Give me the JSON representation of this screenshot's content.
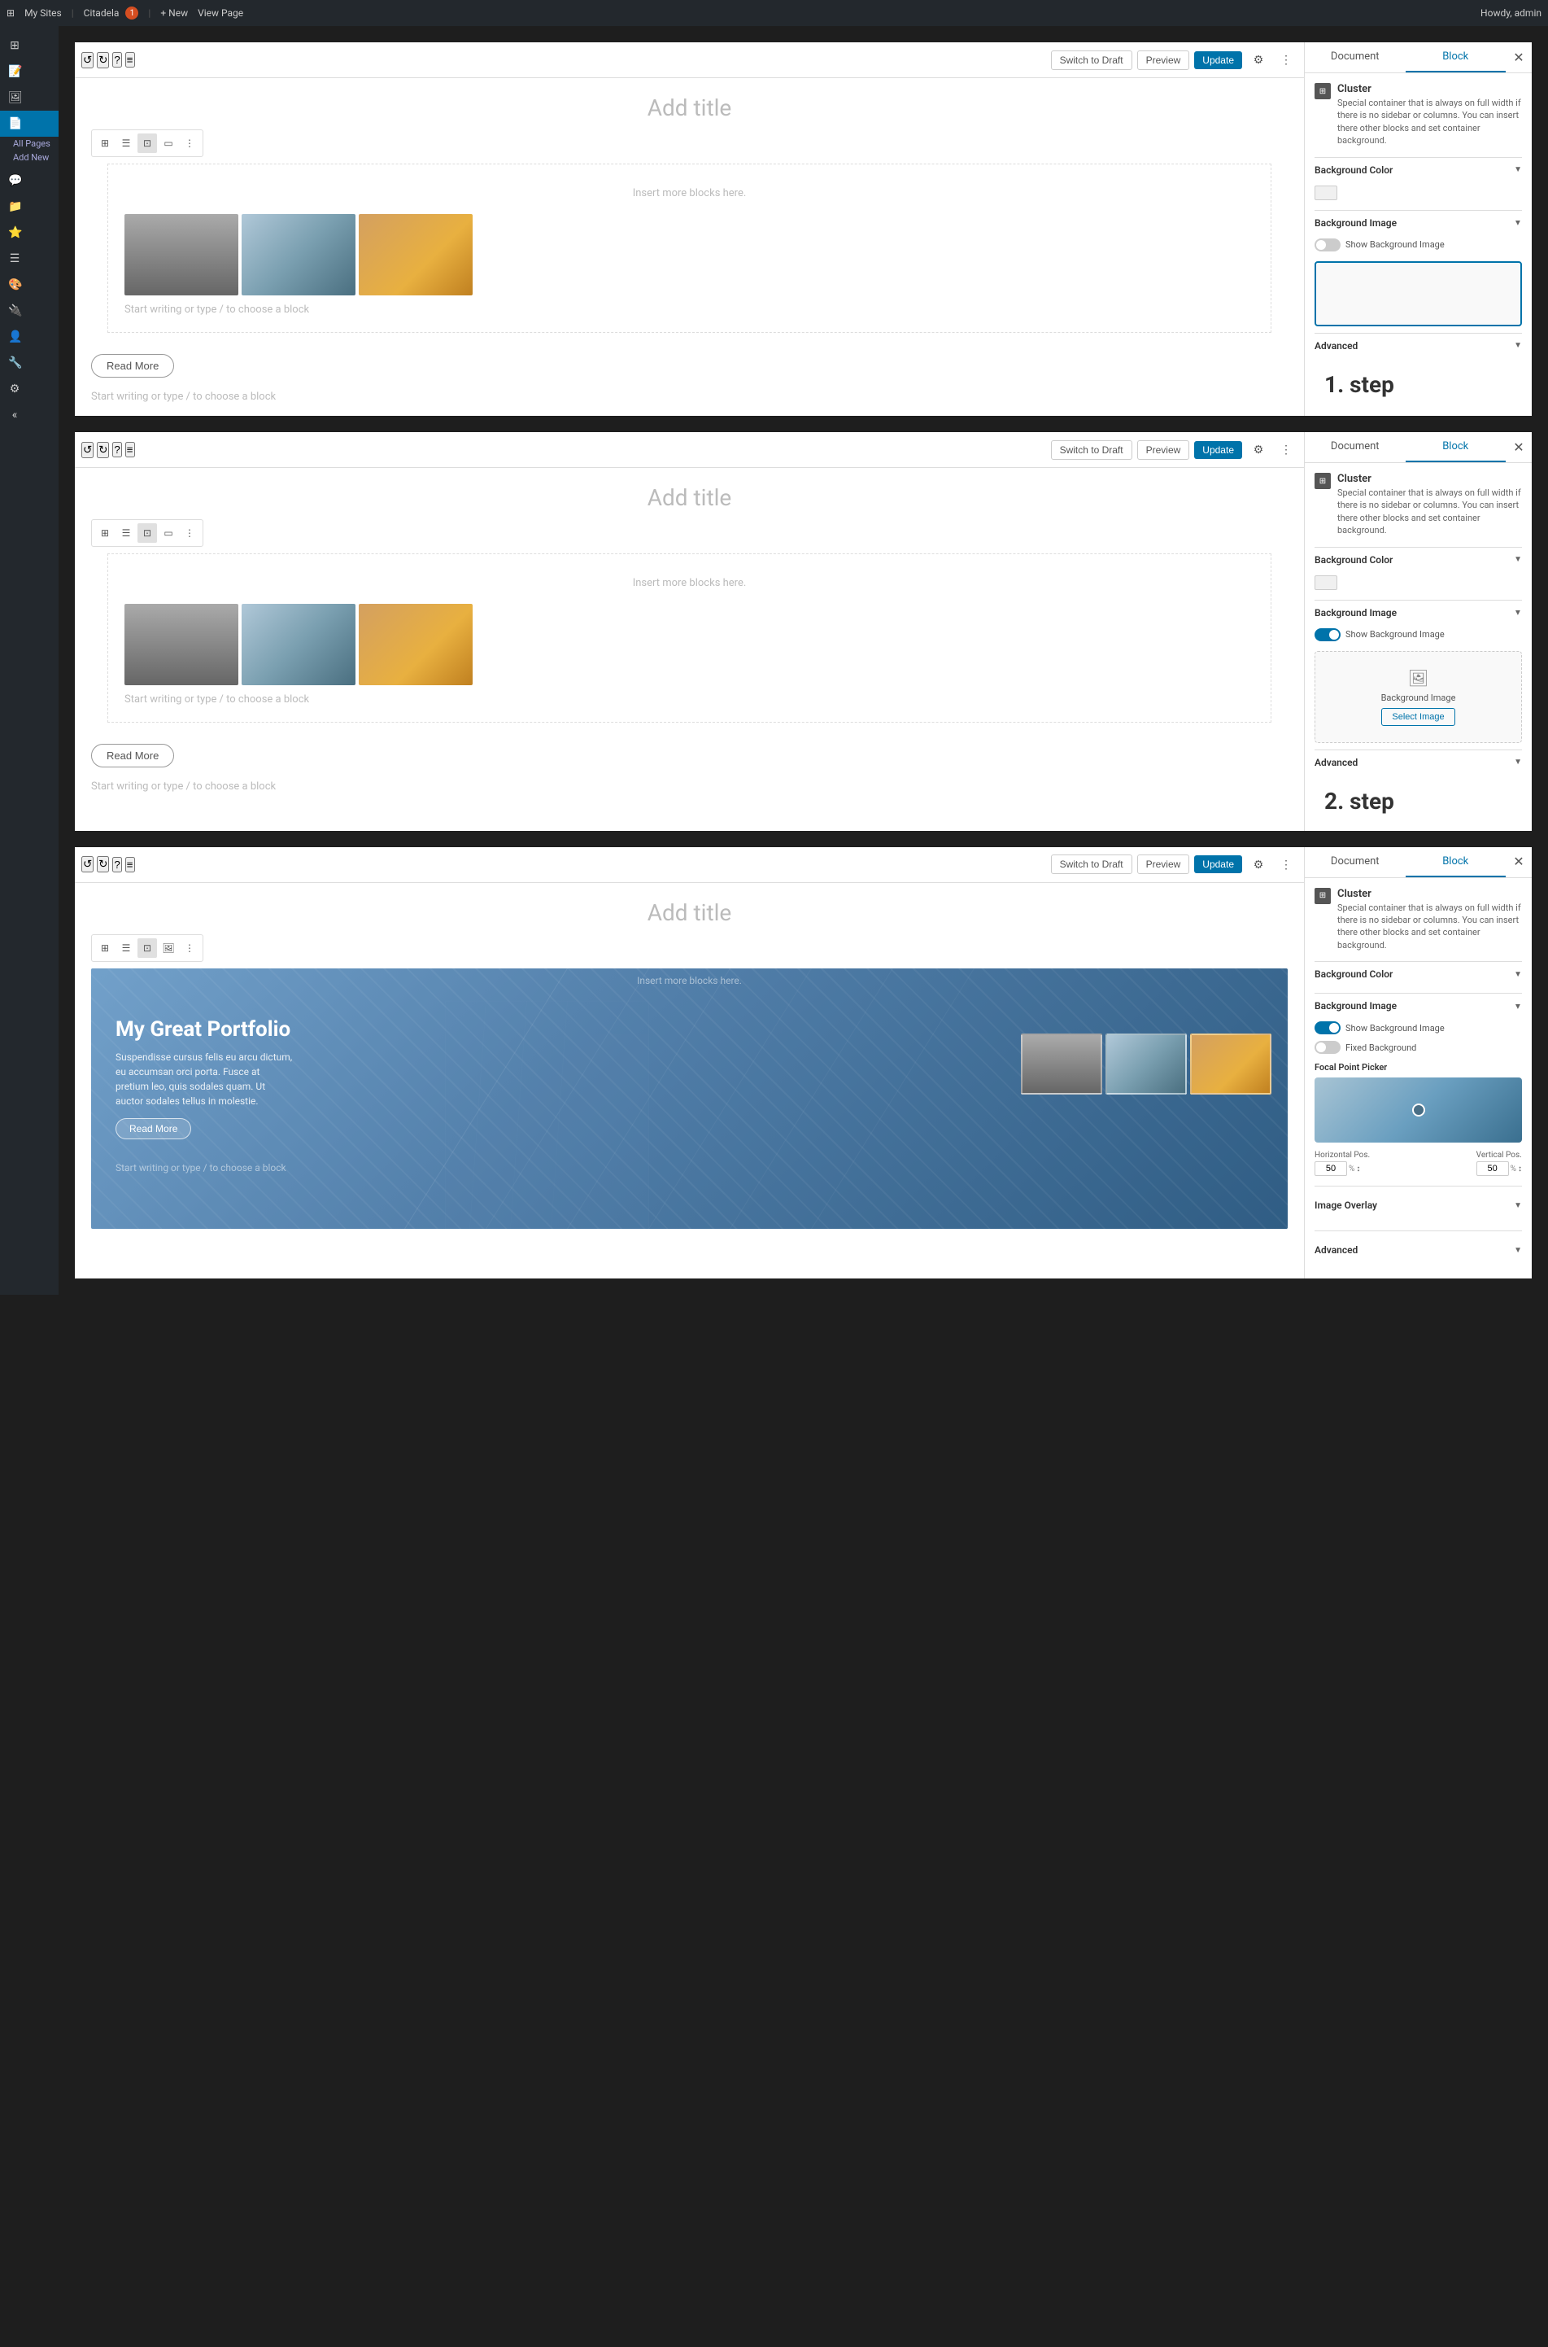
{
  "adminBar": {
    "mySites": "My Sites",
    "siteName": "Citadela",
    "notifs": "1",
    "new": "+ New",
    "viewPage": "View Page",
    "howdy": "Howdy, admin"
  },
  "sidebar": {
    "items": [
      {
        "id": "dashboard",
        "label": "Dashboard",
        "icon": "⊞"
      },
      {
        "id": "posts",
        "label": "Posts",
        "icon": "📝"
      },
      {
        "id": "media",
        "label": "Media",
        "icon": "🖼"
      },
      {
        "id": "pages",
        "label": "Pages",
        "icon": "📄",
        "active": true
      },
      {
        "id": "comments",
        "label": "Comments",
        "icon": "💬"
      },
      {
        "id": "citadela-directory",
        "label": "Citadela Directory",
        "icon": "📁"
      },
      {
        "id": "citadela-pro",
        "label": "Citadela Pro",
        "icon": "⭐"
      },
      {
        "id": "items",
        "label": "Items",
        "icon": "☰"
      },
      {
        "id": "appearance",
        "label": "Appearance",
        "icon": "🎨"
      },
      {
        "id": "plugins",
        "label": "Plugins",
        "icon": "🔌"
      },
      {
        "id": "users",
        "label": "Users",
        "icon": "👤"
      },
      {
        "id": "tools",
        "label": "Tools",
        "icon": "🔧"
      },
      {
        "id": "settings",
        "label": "Settings",
        "icon": "⚙"
      },
      {
        "id": "collapse",
        "label": "Collapse menu",
        "icon": "«"
      }
    ],
    "submenuPages": [
      {
        "id": "all-pages",
        "label": "All Pages"
      },
      {
        "id": "add-new",
        "label": "Add New"
      }
    ]
  },
  "panels": [
    {
      "id": "panel1",
      "toolbar": {
        "undo": "↺",
        "redo": "↻",
        "info": "?",
        "menu": "≡",
        "switchDraft": "Switch to Draft",
        "preview": "Preview",
        "update": "Update"
      },
      "canvas": {
        "pageTitle": "Add title",
        "insertPlaceholder": "Insert more blocks here.",
        "galleryImages": [
          "Black and white city",
          "City skyline blue",
          "City warm"
        ],
        "startWriting1": "Start writing or type / to choose a block",
        "startWriting2": "Start writing or type / to choose a block",
        "readMore": "Read More"
      },
      "settings": {
        "tabs": [
          "Document",
          "Block"
        ],
        "activeTab": "Block",
        "blockName": "Cluster",
        "blockDesc": "Special container that is always on full width if there is no sidebar or columns. You can insert there other blocks and set container background.",
        "sections": [
          {
            "id": "bg-color",
            "label": "Background Color",
            "expanded": false,
            "colorSwatch": "#f0f0f0"
          },
          {
            "id": "bg-image",
            "label": "Background Image",
            "expanded": true,
            "toggle": {
              "state": "off",
              "label": "Show Background Image"
            },
            "imageBox": "empty"
          },
          {
            "id": "advanced",
            "label": "Advanced",
            "expanded": false
          }
        ],
        "stepLabel": "1. step"
      }
    },
    {
      "id": "panel2",
      "toolbar": {
        "undo": "↺",
        "redo": "↻",
        "info": "?",
        "menu": "≡",
        "switchDraft": "Switch to Draft",
        "preview": "Preview",
        "update": "Update"
      },
      "canvas": {
        "pageTitle": "Add title",
        "insertPlaceholder": "Insert more blocks here.",
        "galleryImages": [
          "Black and white city",
          "City skyline blue",
          "City warm"
        ],
        "startWriting1": "Start writing or type / to choose a block",
        "startWriting2": "Start writing or type / to choose a block",
        "readMore": "Read More"
      },
      "settings": {
        "tabs": [
          "Document",
          "Block"
        ],
        "activeTab": "Block",
        "blockName": "Cluster",
        "blockDesc": "Special container that is always on full width if there is no sidebar or columns. You can insert there other blocks and set container background.",
        "sections": [
          {
            "id": "bg-color",
            "label": "Background Color",
            "expanded": false,
            "colorSwatch": "#f0f0f0"
          },
          {
            "id": "bg-image",
            "label": "Background Image",
            "expanded": true,
            "toggle": {
              "state": "on",
              "label": "Show Background Image"
            },
            "imageBox": "select"
          },
          {
            "id": "advanced",
            "label": "Advanced",
            "expanded": false
          }
        ],
        "selectImageBtn": "Select Image",
        "backgroundImageLabel": "Background Image",
        "stepLabel": "2. step"
      }
    },
    {
      "id": "panel3",
      "toolbar": {
        "undo": "↺",
        "redo": "↻",
        "info": "?",
        "menu": "≡",
        "switchDraft": "Switch to Draft",
        "preview": "Preview",
        "update": "Update"
      },
      "canvas": {
        "pageTitle": "Add title",
        "insertPlaceholder": "Insert more blocks here.",
        "portfolioTitle": "My Great Portfolio",
        "portfolioDesc": "Suspendisse cursus felis eu arcu dictum, eu accumsan orci porta. Fusce at pretium leo, quis sodales quam. Ut auctor sodales tellus in molestie.",
        "readMore": "Read More",
        "startWriting": "Start writing or type / to choose a block"
      },
      "settings": {
        "tabs": [
          "Document",
          "Block"
        ],
        "activeTab": "Block",
        "blockName": "Cluster",
        "blockDesc": "Special container that is always on full width if there is no sidebar or columns. You can insert there other blocks and set container background.",
        "sections": [
          {
            "id": "bg-color",
            "label": "Background Color",
            "expanded": false
          },
          {
            "id": "bg-image",
            "label": "Background Image",
            "expanded": true,
            "toggleShow": {
              "state": "on",
              "label": "Show Background Image"
            },
            "toggleFixed": {
              "state": "off",
              "label": "Fixed Background"
            },
            "focalPointPicker": "Focal Point Picker",
            "horizontalPos": "50",
            "verticalPos": "50",
            "horizontalLabel": "Horizontal Pos.",
            "verticalLabel": "Vertical Pos."
          },
          {
            "id": "image-overlay",
            "label": "Image Overlay",
            "expanded": false
          },
          {
            "id": "advanced",
            "label": "Advanced",
            "expanded": false
          }
        ]
      }
    }
  ],
  "blockToolbar": {
    "buttons": [
      "⊞",
      "☰",
      "⊡",
      "⊟",
      "⋮"
    ]
  },
  "colors": {
    "wpBlue": "#0073aa",
    "adminBarBg": "#23282d",
    "sidebarBg": "#23282d",
    "activePage": "#0073aa",
    "updateBtn": "#0073aa",
    "borderColor": "#ddd",
    "activeTabColor": "#0073aa"
  }
}
